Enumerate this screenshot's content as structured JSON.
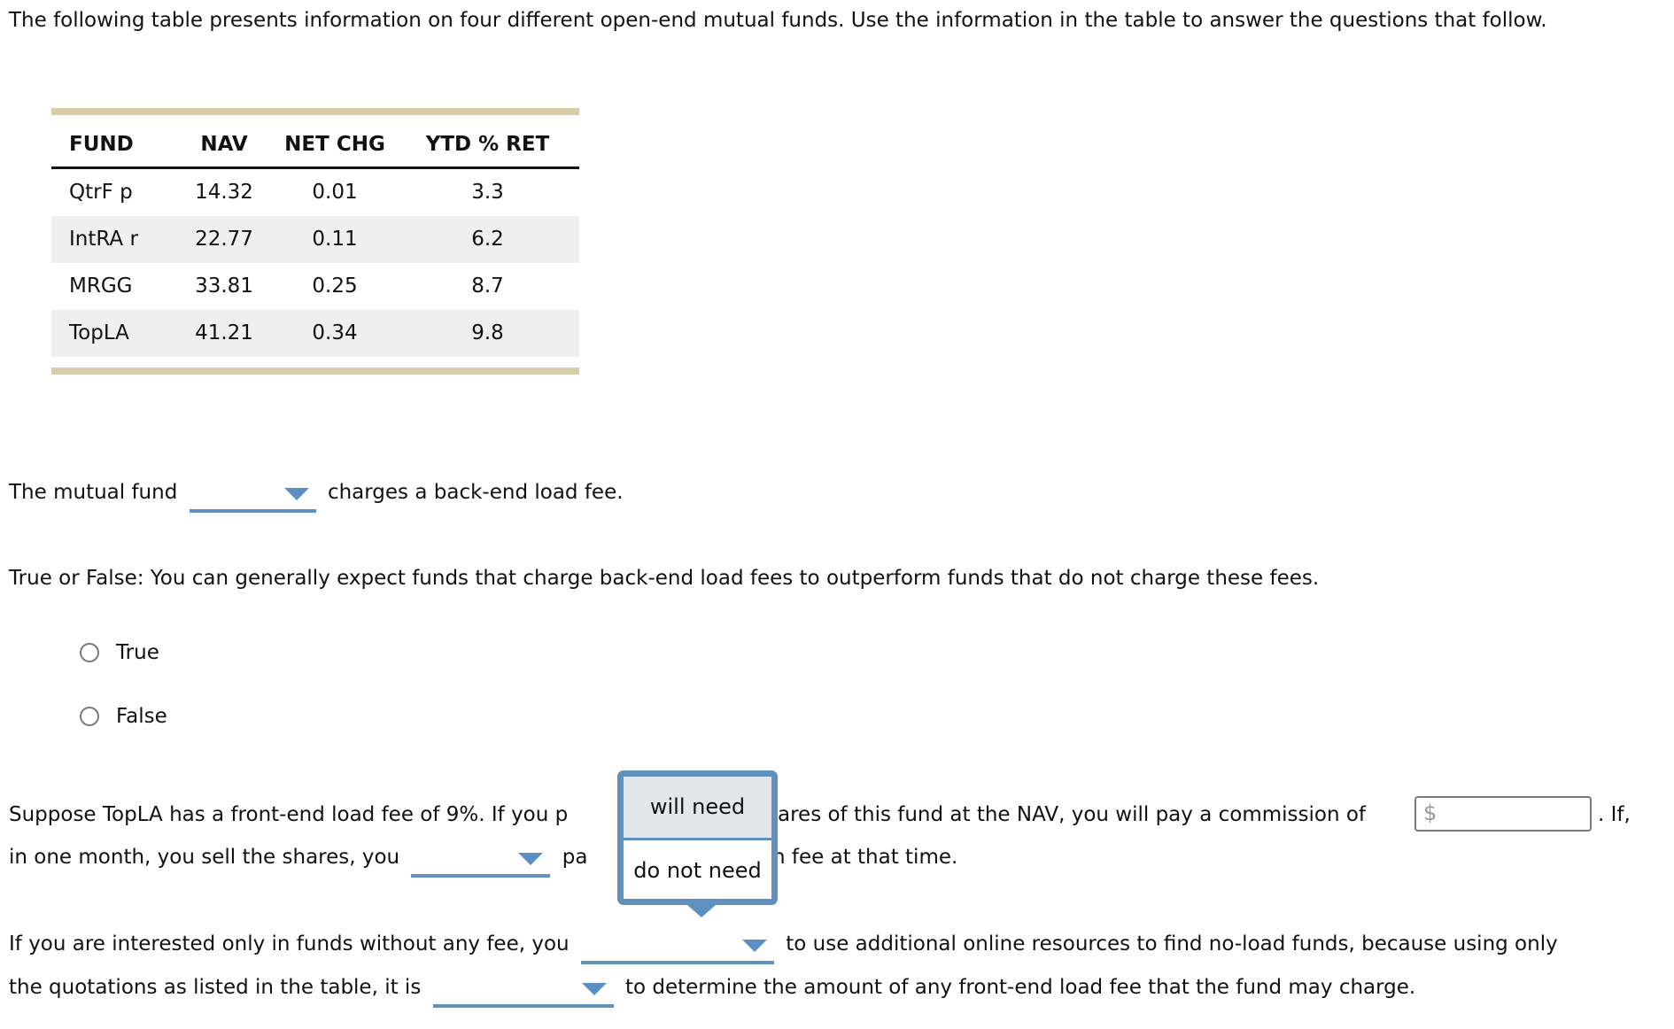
{
  "intro": "The following table presents information on four different open-end mutual funds. Use the information in the table to answer the questions that follow.",
  "table": {
    "headers": [
      "FUND",
      "NAV",
      "NET CHG",
      "YTD % RET"
    ],
    "rows": [
      [
        "QtrF p",
        "14.32",
        "0.01",
        "3.3"
      ],
      [
        "IntRA r",
        "22.77",
        "0.11",
        "6.2"
      ],
      [
        "MRGG",
        "33.81",
        "0.25",
        "8.7"
      ],
      [
        "TopLA",
        "41.21",
        "0.34",
        "9.8"
      ]
    ]
  },
  "q1": {
    "before": "The mutual fund",
    "after": "charges a back-end load fee.",
    "selected": ""
  },
  "q2": {
    "prompt": "True or False: You can generally expect funds that charge back-end load fees to outperform funds that do not charge these fees.",
    "options": [
      "True",
      "False"
    ]
  },
  "q3": {
    "line1_a": "Suppose TopLA has a front-end load fee of 9%. If you p",
    "line1_b": "ares of this fund at the NAV, you will pay a commission of",
    "line1_c": ". If,",
    "currency_symbol": "$",
    "line2_a": "in one month, you sell the shares, you",
    "line2_b": "pa",
    "line2_c": "n fee at that time.",
    "selected": ""
  },
  "popup": {
    "options": [
      "will need",
      "do not need"
    ],
    "highlighted": "will need"
  },
  "q4": {
    "line1_a": "If you are interested only in funds without any fee, you",
    "line1_b": "to use additional online resources to find no-load funds, because using only",
    "line2_a": "the quotations as listed in the table, it is",
    "line2_b": "to determine the amount of any front-end load fee that the fund may charge.",
    "selected_1": "",
    "selected_2": ""
  },
  "colors": {
    "accent": "#6090c0",
    "table_bar": "#d9cca8",
    "row_alt": "#efefef",
    "popup_highlight": "#e1e7ea"
  }
}
